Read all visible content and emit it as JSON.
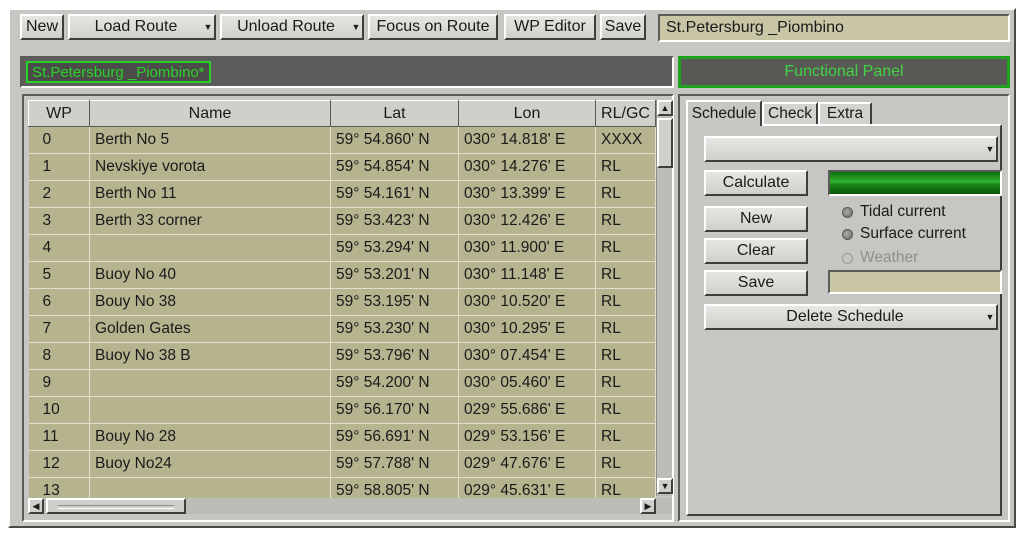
{
  "toolbar": {
    "new_label": "New",
    "load_route_label": "Load Route",
    "unload_route_label": "Unload Route",
    "focus_label": "Focus on Route",
    "wp_editor_label": "WP Editor",
    "save_label": "Save",
    "route_name": "St.Petersburg _Piombino"
  },
  "status": {
    "route_label": "St.Petersburg _Piombino*",
    "functional_panel": "Functional Panel"
  },
  "table": {
    "columns": [
      "WP",
      "Name",
      "Lat",
      "Lon",
      "RL/GC"
    ],
    "rows": [
      {
        "wp": "0",
        "name": "Berth No 5",
        "lat": "59° 54.860' N",
        "lon": "030° 14.818' E",
        "type": "XXXX"
      },
      {
        "wp": "1",
        "name": "Nevskiye vorota",
        "lat": "59° 54.854' N",
        "lon": "030° 14.276' E",
        "type": "RL"
      },
      {
        "wp": "2",
        "name": "Berth No 11",
        "lat": "59° 54.161' N",
        "lon": "030° 13.399' E",
        "type": "RL"
      },
      {
        "wp": "3",
        "name": "Berth 33 corner",
        "lat": "59° 53.423' N",
        "lon": "030° 12.426' E",
        "type": "RL"
      },
      {
        "wp": "4",
        "name": "",
        "lat": "59° 53.294' N",
        "lon": "030° 11.900' E",
        "type": "RL"
      },
      {
        "wp": "5",
        "name": "Buoy No 40",
        "lat": "59° 53.201' N",
        "lon": "030° 11.148' E",
        "type": "RL"
      },
      {
        "wp": "6",
        "name": "Bouy No 38",
        "lat": "59° 53.195' N",
        "lon": "030° 10.520' E",
        "type": "RL"
      },
      {
        "wp": "7",
        "name": "Golden Gates",
        "lat": "59° 53.230' N",
        "lon": "030° 10.295' E",
        "type": "RL"
      },
      {
        "wp": "8",
        "name": "Buoy No 38 B",
        "lat": "59° 53.796' N",
        "lon": "030° 07.454' E",
        "type": "RL"
      },
      {
        "wp": "9",
        "name": "",
        "lat": "59° 54.200' N",
        "lon": "030° 05.460' E",
        "type": "RL"
      },
      {
        "wp": "10",
        "name": "",
        "lat": "59° 56.170' N",
        "lon": "029° 55.686' E",
        "type": "RL"
      },
      {
        "wp": "11",
        "name": "Bouy No 28",
        "lat": "59° 56.691' N",
        "lon": "029° 53.156' E",
        "type": "RL"
      },
      {
        "wp": "12",
        "name": "Buoy No24",
        "lat": "59° 57.788' N",
        "lon": "029° 47.676' E",
        "type": "RL"
      },
      {
        "wp": "13",
        "name": "",
        "lat": "59° 58.805' N",
        "lon": "029° 45.631' E",
        "type": "RL"
      }
    ]
  },
  "panel": {
    "tabs": [
      "Schedule",
      "Check",
      "Extra"
    ],
    "active_tab": "Schedule",
    "calculate_label": "Calculate",
    "new_label": "New",
    "clear_label": "Clear",
    "save_label": "Save",
    "delete_schedule_label": "Delete Schedule",
    "schedule_select_value": "",
    "radios": {
      "tidal": "Tidal current",
      "surface": "Surface current",
      "weather": "Weather"
    },
    "progress_color": "#2fb42f"
  },
  "icons": {
    "dropdown": "triangle-down",
    "scroll_up": "triangle-up",
    "scroll_down": "triangle-down",
    "scroll_left": "triangle-left",
    "scroll_right": "triangle-right"
  }
}
